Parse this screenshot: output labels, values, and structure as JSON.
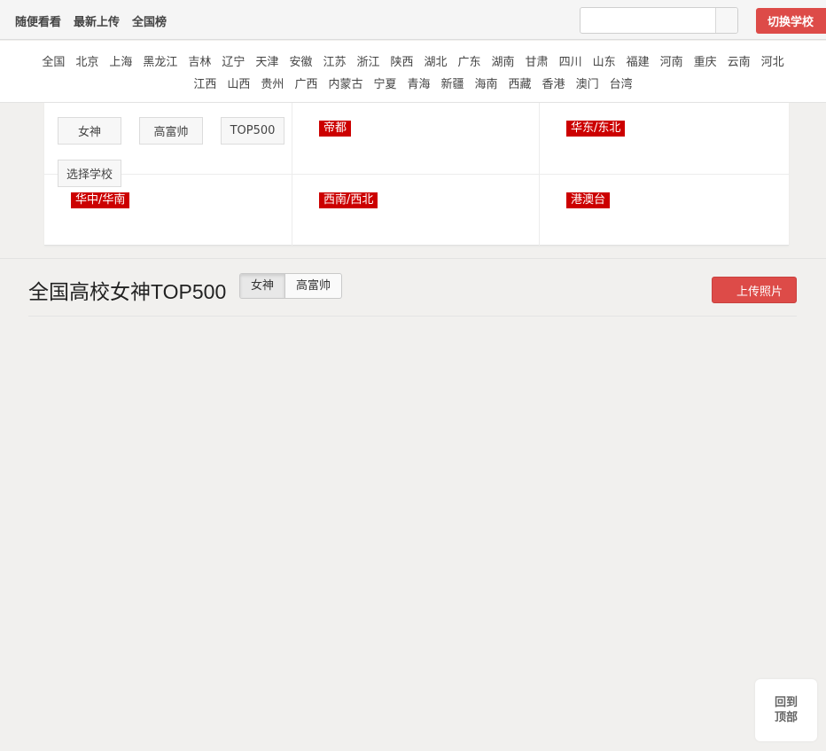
{
  "topnav": {
    "items": [
      "随便看看",
      "最新上传",
      "全国榜"
    ]
  },
  "search": {
    "value": "",
    "placeholder": ""
  },
  "switch_school": "切换学校",
  "regions": {
    "row1": [
      "全国",
      "北京",
      "上海",
      "黑龙江",
      "吉林",
      "辽宁",
      "天津",
      "安徽",
      "江苏",
      "浙江",
      "陕西",
      "湖北",
      "广东",
      "湖南",
      "甘肃",
      "四川",
      "山东",
      "福建",
      "河南",
      "重庆",
      "云南",
      "河北"
    ],
    "row2": [
      "江西",
      "山西",
      "贵州",
      "广西",
      "内蒙古",
      "宁夏",
      "青海",
      "新疆",
      "海南",
      "西藏",
      "香港",
      "澳门",
      "台湾"
    ]
  },
  "panel": {
    "buttons": [
      "女神",
      "高富帅",
      "TOP500",
      "选择学校"
    ],
    "tags": [
      "帝都",
      "华东/东北",
      "华中/华南",
      "西南/西北",
      "港澳台"
    ]
  },
  "main": {
    "title": "全国高校女神TOP500",
    "segments": [
      "女神",
      "高富帅"
    ],
    "upload": "上传照片"
  },
  "back_to_top": {
    "line1": "回到",
    "line2": "顶部"
  },
  "colors": {
    "accent": "#dd4b48",
    "tag": "#cc0000"
  }
}
